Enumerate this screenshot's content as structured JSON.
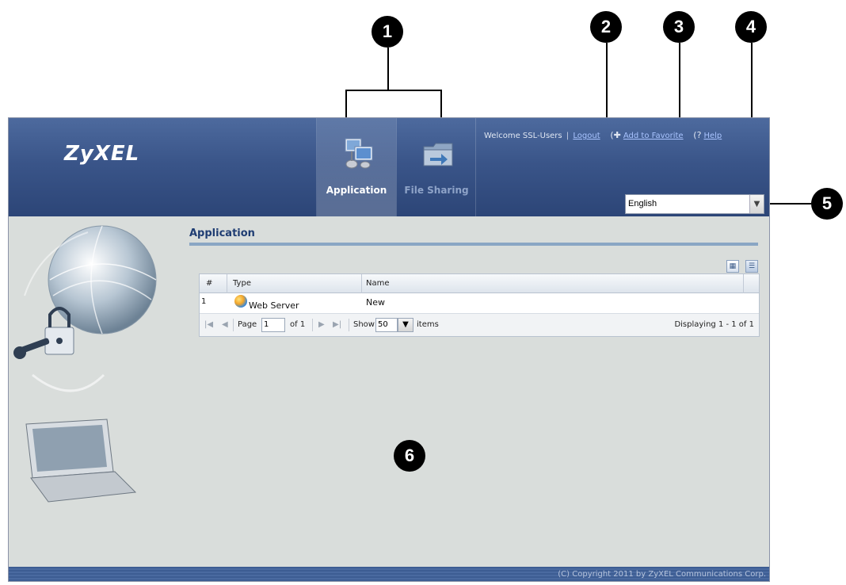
{
  "callouts": [
    "1",
    "2",
    "3",
    "4",
    "5",
    "6"
  ],
  "header": {
    "logo": "ZyXEL",
    "tabs": [
      {
        "label": "Application",
        "active": true,
        "icon": "application-icon"
      },
      {
        "label": "File Sharing",
        "active": false,
        "icon": "file-sharing-icon"
      }
    ],
    "welcome": "Welcome SSL-Users",
    "separator": "|",
    "logout": "Logout",
    "add_to_favorite": "Add to Favorite",
    "help": "Help",
    "language": "English"
  },
  "content": {
    "title": "Application",
    "grid": {
      "columns": [
        "#",
        "Type",
        "Name"
      ],
      "rows": [
        {
          "num": "1",
          "type": "Web Server",
          "name": "New",
          "icon": "web-server-globe-icon"
        }
      ]
    },
    "pager": {
      "page_label": "Page",
      "page_value": "1",
      "of_label": "of 1",
      "show_label": "Show",
      "show_value": "50",
      "items_label": "items",
      "displaying": "Displaying 1 - 1 of 1"
    }
  },
  "footer": {
    "copyright": "(C) Copyright 2011 by ZyXEL Communications Corp."
  },
  "colors": {
    "header": "#3a5589",
    "accent": "#1f3d73",
    "link": "#a9c4ff"
  }
}
